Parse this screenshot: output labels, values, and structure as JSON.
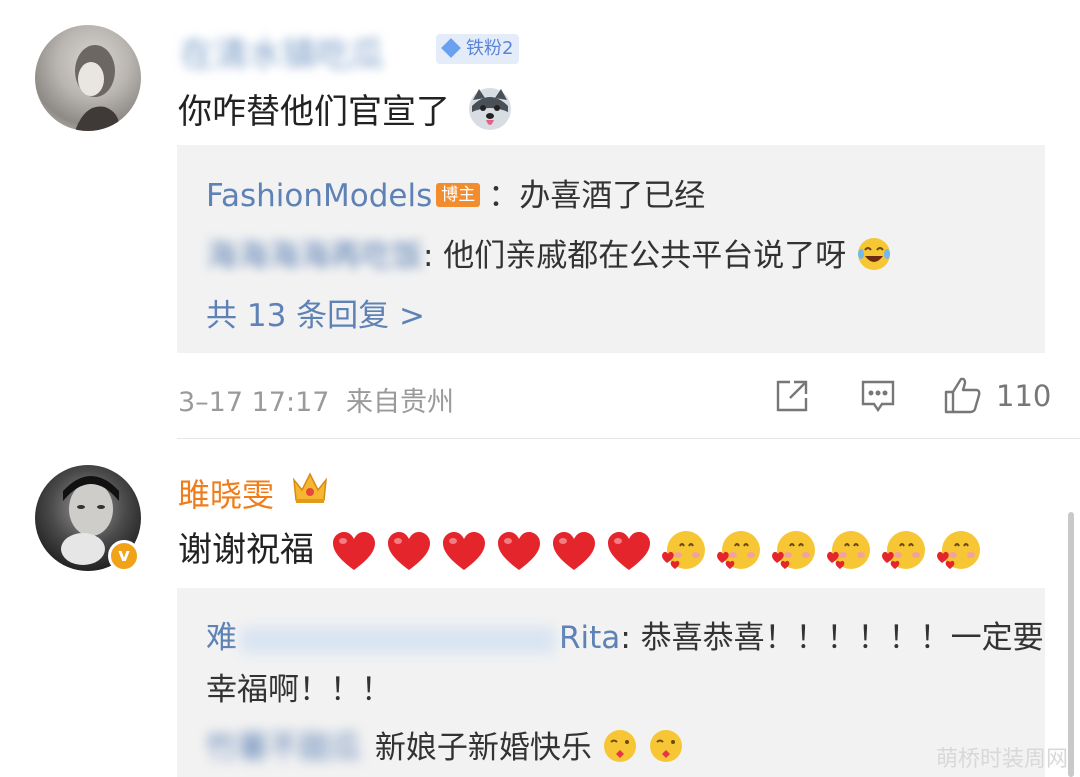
{
  "comment1": {
    "username_blurred": "在清水镇吃瓜",
    "badge": "铁粉2",
    "text": "你咋替他们官宣了",
    "emoji": "husky-dog-emoji",
    "replies": [
      {
        "user": "FashionModels",
        "badge": "博主",
        "text": "：办喜酒了已经"
      },
      {
        "user_blurred": "海海海海再吃饭",
        "text": ": 他们亲戚都在公共平台说了呀",
        "emoji": "laugh-cry-emoji"
      }
    ],
    "more_replies": "共 13 条回复 >",
    "timestamp": "3–17 17:17",
    "location": "来自贵州",
    "likes": "110"
  },
  "comment2": {
    "username": "雎晓雯",
    "text": "谢谢祝福",
    "hearts": 6,
    "faces": 6,
    "replies": [
      {
        "user_blurred_prefix": "难",
        "user_tail": "Rita",
        "text": ": 恭喜恭喜！！！！！！一定要",
        "text2": "幸福啊！！！"
      },
      {
        "user_blurred": "竹薯不甜瓜",
        "text": "新娘子新婚快乐"
      }
    ]
  },
  "watermark": "萌桥时装周网",
  "colors": {
    "link": "#5e82b5",
    "orange": "#f07d1a",
    "reply_bg": "#f2f2f2",
    "meta": "#9a9a9a"
  }
}
